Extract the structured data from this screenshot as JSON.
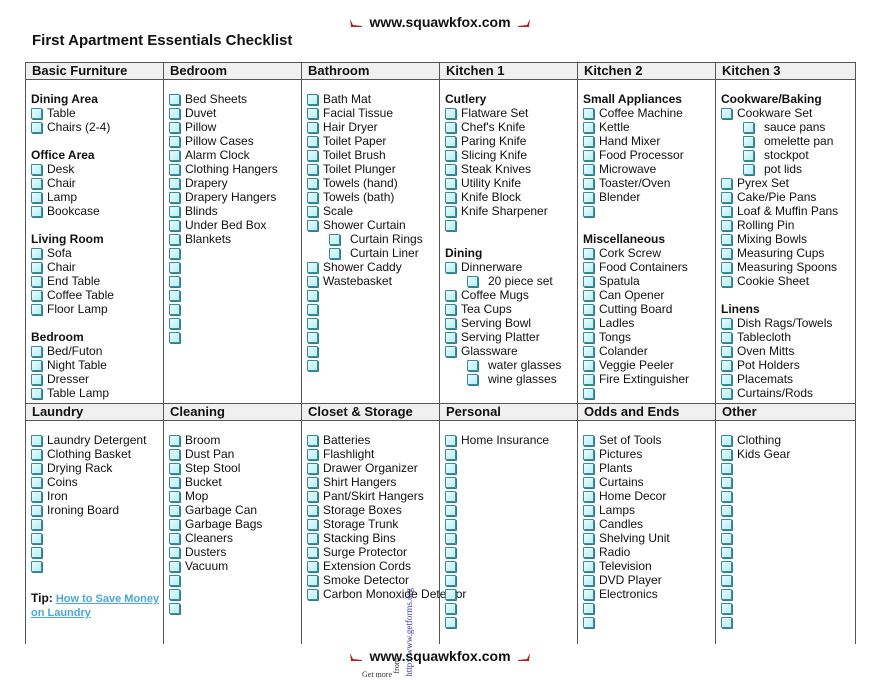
{
  "header": {
    "site": "www.squawkfox.com",
    "shoe_icon": "high-heel-icon"
  },
  "title": "First Apartment Essentials Checklist",
  "colors": {
    "checkbox_border": "#3a8a9a",
    "checkbox_fill": "#b8eef2",
    "link": "#4aa8d8",
    "shoe": "#b22222"
  },
  "top_row": [
    {
      "header": "Basic Furniture",
      "groups": [
        {
          "title": "Dining Area",
          "items": [
            {
              "label": "Table"
            },
            {
              "label": "Chairs (2-4)"
            }
          ]
        },
        {
          "title": "Office Area",
          "items": [
            {
              "label": "Desk"
            },
            {
              "label": "Chair"
            },
            {
              "label": "Lamp"
            },
            {
              "label": "Bookcase"
            }
          ]
        },
        {
          "title": "Living Room",
          "items": [
            {
              "label": "Sofa"
            },
            {
              "label": "Chair"
            },
            {
              "label": "End Table"
            },
            {
              "label": "Coffee Table"
            },
            {
              "label": "Floor Lamp"
            }
          ]
        },
        {
          "title": "Bedroom",
          "items": [
            {
              "label": "Bed/Futon"
            },
            {
              "label": "Night Table"
            },
            {
              "label": "Dresser"
            },
            {
              "label": "Table Lamp"
            }
          ]
        }
      ]
    },
    {
      "header": "Bedroom",
      "groups": [
        {
          "title": "",
          "items": [
            {
              "label": "Bed Sheets"
            },
            {
              "label": "Duvet"
            },
            {
              "label": "Pillow"
            },
            {
              "label": "Pillow Cases"
            },
            {
              "label": "Alarm Clock"
            },
            {
              "label": "Clothing Hangers"
            },
            {
              "label": "Drapery"
            },
            {
              "label": "Drapery Hangers"
            },
            {
              "label": "Blinds"
            },
            {
              "label": "Under Bed Box"
            },
            {
              "label": "Blankets"
            },
            {
              "label": ""
            },
            {
              "label": ""
            },
            {
              "label": ""
            },
            {
              "label": ""
            },
            {
              "label": ""
            },
            {
              "label": ""
            },
            {
              "label": ""
            }
          ]
        }
      ]
    },
    {
      "header": "Bathroom",
      "groups": [
        {
          "title": "",
          "items": [
            {
              "label": "Bath Mat"
            },
            {
              "label": "Facial Tissue"
            },
            {
              "label": "Hair Dryer"
            },
            {
              "label": "Toilet Paper"
            },
            {
              "label": "Toilet Brush"
            },
            {
              "label": "Toilet Plunger"
            },
            {
              "label": "Towels (hand)"
            },
            {
              "label": "Towels (bath)"
            },
            {
              "label": "Scale"
            },
            {
              "label": "Shower Curtain"
            },
            {
              "label": "Curtain Rings",
              "sub": true
            },
            {
              "label": "Curtain Liner",
              "sub": true
            },
            {
              "label": "Shower Caddy"
            },
            {
              "label": "Wastebasket"
            },
            {
              "label": ""
            },
            {
              "label": ""
            },
            {
              "label": ""
            },
            {
              "label": ""
            },
            {
              "label": ""
            },
            {
              "label": ""
            }
          ]
        }
      ]
    },
    {
      "header": "Kitchen 1",
      "groups": [
        {
          "title": "Cutlery",
          "items": [
            {
              "label": "Flatware Set"
            },
            {
              "label": "Chef's Knife"
            },
            {
              "label": "Paring Knife"
            },
            {
              "label": "Slicing Knife"
            },
            {
              "label": "Steak Knives"
            },
            {
              "label": "Utility Knife"
            },
            {
              "label": "Knife Block"
            },
            {
              "label": "Knife Sharpener"
            },
            {
              "label": ""
            }
          ]
        },
        {
          "title": "Dining",
          "items": [
            {
              "label": "Dinnerware"
            },
            {
              "label": "20 piece set",
              "sub": true
            },
            {
              "label": "Coffee Mugs"
            },
            {
              "label": "Tea Cups"
            },
            {
              "label": "Serving Bowl"
            },
            {
              "label": "Serving Platter"
            },
            {
              "label": "Glassware"
            },
            {
              "label": "water glasses",
              "sub": true
            },
            {
              "label": "wine glasses",
              "sub": true
            }
          ]
        }
      ]
    },
    {
      "header": "Kitchen 2",
      "groups": [
        {
          "title": "Small Appliances",
          "items": [
            {
              "label": "Coffee Machine"
            },
            {
              "label": "Kettle"
            },
            {
              "label": "Hand Mixer"
            },
            {
              "label": "Food Processor"
            },
            {
              "label": "Microwave"
            },
            {
              "label": "Toaster/Oven"
            },
            {
              "label": "Blender"
            },
            {
              "label": ""
            }
          ]
        },
        {
          "title": "Miscellaneous",
          "items": [
            {
              "label": "Cork Screw"
            },
            {
              "label": "Food Containers"
            },
            {
              "label": "Spatula"
            },
            {
              "label": "Can Opener"
            },
            {
              "label": "Cutting Board"
            },
            {
              "label": "Ladles"
            },
            {
              "label": "Tongs"
            },
            {
              "label": "Colander"
            },
            {
              "label": "Veggie Peeler"
            },
            {
              "label": "Fire Extinguisher"
            },
            {
              "label": ""
            }
          ]
        }
      ]
    },
    {
      "header": "Kitchen 3",
      "groups": [
        {
          "title": "Cookware/Baking",
          "items": [
            {
              "label": "Cookware Set"
            },
            {
              "label": "sauce pans",
              "sub": true
            },
            {
              "label": "omelette pan",
              "sub": true
            },
            {
              "label": "stockpot",
              "sub": true
            },
            {
              "label": "pot lids",
              "sub": true
            },
            {
              "label": "Pyrex Set"
            },
            {
              "label": "Cake/Pie Pans"
            },
            {
              "label": "Loaf & Muffin Pans"
            },
            {
              "label": "Rolling Pin"
            },
            {
              "label": "Mixing Bowls"
            },
            {
              "label": "Measuring Cups"
            },
            {
              "label": "Measuring Spoons"
            },
            {
              "label": "Cookie Sheet"
            }
          ]
        },
        {
          "title": "Linens",
          "items": [
            {
              "label": "Dish Rags/Towels"
            },
            {
              "label": "Tablecloth"
            },
            {
              "label": "Oven Mitts"
            },
            {
              "label": "Pot Holders"
            },
            {
              "label": "Placemats"
            },
            {
              "label": "Curtains/Rods"
            }
          ]
        }
      ]
    }
  ],
  "bottom_row": [
    {
      "header": "Laundry",
      "groups": [
        {
          "title": "",
          "items": [
            {
              "label": "Laundry Detergent"
            },
            {
              "label": "Clothing Basket"
            },
            {
              "label": "Drying Rack"
            },
            {
              "label": "Coins"
            },
            {
              "label": "Iron"
            },
            {
              "label": "Ironing Board"
            },
            {
              "label": ""
            },
            {
              "label": ""
            },
            {
              "label": ""
            },
            {
              "label": ""
            }
          ]
        }
      ],
      "tip": {
        "label": "Tip:",
        "link": "How to Save Money on Laundry"
      }
    },
    {
      "header": "Cleaning",
      "groups": [
        {
          "title": "",
          "items": [
            {
              "label": "Broom"
            },
            {
              "label": "Dust Pan"
            },
            {
              "label": "Step Stool"
            },
            {
              "label": "Bucket"
            },
            {
              "label": "Mop"
            },
            {
              "label": "Garbage Can"
            },
            {
              "label": "Garbage Bags"
            },
            {
              "label": "Cleaners"
            },
            {
              "label": "Dusters"
            },
            {
              "label": "Vacuum"
            },
            {
              "label": ""
            },
            {
              "label": ""
            },
            {
              "label": ""
            }
          ]
        }
      ]
    },
    {
      "header": "Closet & Storage",
      "groups": [
        {
          "title": "",
          "items": [
            {
              "label": "Batteries"
            },
            {
              "label": "Flashlight"
            },
            {
              "label": "Drawer Organizer"
            },
            {
              "label": "Shirt Hangers"
            },
            {
              "label": "Pant/Skirt Hangers"
            },
            {
              "label": "Storage Boxes"
            },
            {
              "label": "Storage Trunk"
            },
            {
              "label": "Stacking Bins"
            },
            {
              "label": "Surge Protector"
            },
            {
              "label": "Extension Cords"
            },
            {
              "label": "Smoke Detector"
            },
            {
              "label": "Carbon Monoxide Detector",
              "wrap": true
            }
          ]
        }
      ]
    },
    {
      "header": "Personal",
      "groups": [
        {
          "title": "",
          "items": [
            {
              "label": "Home Insurance"
            },
            {
              "label": ""
            },
            {
              "label": ""
            },
            {
              "label": ""
            },
            {
              "label": ""
            },
            {
              "label": ""
            },
            {
              "label": ""
            },
            {
              "label": ""
            },
            {
              "label": ""
            },
            {
              "label": ""
            },
            {
              "label": ""
            },
            {
              "label": ""
            },
            {
              "label": ""
            },
            {
              "label": ""
            }
          ]
        }
      ]
    },
    {
      "header": "Odds and Ends",
      "groups": [
        {
          "title": "",
          "items": [
            {
              "label": "Set of Tools"
            },
            {
              "label": "Pictures"
            },
            {
              "label": "Plants"
            },
            {
              "label": "Curtains"
            },
            {
              "label": "Home Decor"
            },
            {
              "label": "Lamps"
            },
            {
              "label": "Candles"
            },
            {
              "label": "Shelving Unit"
            },
            {
              "label": "Radio"
            },
            {
              "label": "Television"
            },
            {
              "label": "DVD Player"
            },
            {
              "label": "Electronics"
            },
            {
              "label": ""
            },
            {
              "label": ""
            }
          ]
        }
      ]
    },
    {
      "header": "Other",
      "groups": [
        {
          "title": "",
          "items": [
            {
              "label": "Clothing"
            },
            {
              "label": "Kids Gear"
            },
            {
              "label": ""
            },
            {
              "label": ""
            },
            {
              "label": ""
            },
            {
              "label": ""
            },
            {
              "label": ""
            },
            {
              "label": ""
            },
            {
              "label": ""
            },
            {
              "label": ""
            },
            {
              "label": ""
            },
            {
              "label": ""
            },
            {
              "label": ""
            },
            {
              "label": ""
            }
          ]
        }
      ]
    }
  ],
  "footer": {
    "site": "www.squawkfox.com",
    "watermark": "http://www.getforms.org",
    "get_more": "Get more",
    "from": "from"
  }
}
